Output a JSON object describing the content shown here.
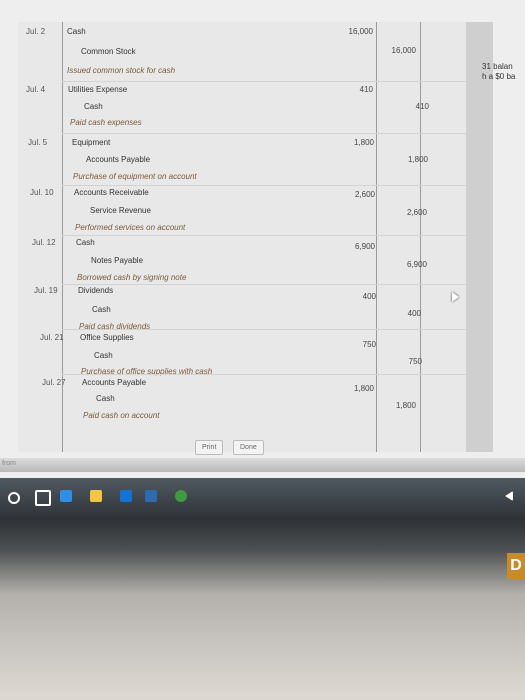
{
  "side_note": [
    "31 balan",
    "h a $0 ba"
  ],
  "buttons": {
    "print": "Print",
    "done": "Done"
  },
  "bottom_fragment": "from",
  "bezel_letter": "D",
  "entries": [
    {
      "date": "Jul. 2",
      "debit": "Cash",
      "credit": "Common Stock",
      "desc": "Issued common stock for cash",
      "amount": "16,000"
    },
    {
      "date": "Jul. 4",
      "debit": "Utilities Expense",
      "credit": "Cash",
      "desc": "Paid cash expenses",
      "amount": "410"
    },
    {
      "date": "Jul. 5",
      "debit": "Equipment",
      "credit": "Accounts Payable",
      "desc": "Purchase of equipment on account",
      "amount": "1,800"
    },
    {
      "date": "Jul. 10",
      "debit": "Accounts Receivable",
      "credit": "Service Revenue",
      "desc": "Performed services on account",
      "amount": "2,600"
    },
    {
      "date": "Jul. 12",
      "debit": "Cash",
      "credit": "Notes Payable",
      "desc": "Borrowed cash by signing note",
      "amount": "6,900"
    },
    {
      "date": "Jul. 19",
      "debit": "Dividends",
      "credit": "Cash",
      "desc": "Paid cash dividends",
      "amount": "400"
    },
    {
      "date": "Jul. 21",
      "debit": "Office Supplies",
      "credit": "Cash",
      "desc": "Purchase of office supplies with cash",
      "amount": "750"
    },
    {
      "date": "Jul. 27",
      "debit": "Accounts Payable",
      "credit": "Cash",
      "desc": "Paid cash on account",
      "amount": "1,800"
    }
  ]
}
